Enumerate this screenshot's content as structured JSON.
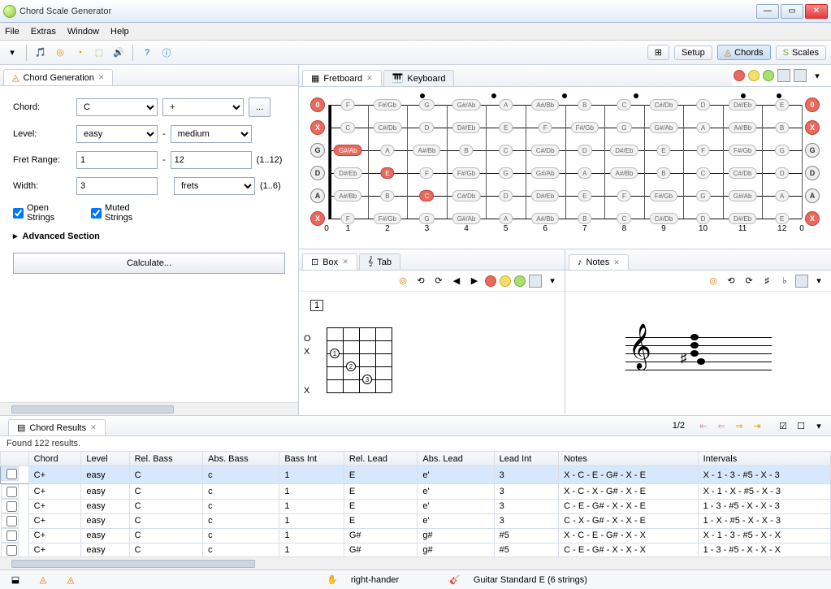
{
  "window": {
    "title": "Chord Scale Generator"
  },
  "menu": [
    "File",
    "Extras",
    "Window",
    "Help"
  ],
  "topmodes": [
    {
      "icon": "layout",
      "label": ""
    },
    {
      "icon": "setup",
      "label": "Setup"
    },
    {
      "icon": "chords",
      "label": "Chords",
      "active": true
    },
    {
      "icon": "scales",
      "label": "Scales"
    }
  ],
  "left": {
    "tab_title": "Chord Generation",
    "labels": {
      "chord": "Chord:",
      "level": "Level:",
      "fretrange": "Fret Range:",
      "width": "Width:"
    },
    "chord_root": "C",
    "chord_qual": "+",
    "dots_btn": "...",
    "level_from": "easy",
    "level_to": "medium",
    "dash": "-",
    "fret_from": "1",
    "fret_to": "12",
    "fret_hint": "(1..12)",
    "width_val": "3",
    "width_unit": "frets",
    "width_hint": "(1..6)",
    "open_strings": "Open Strings",
    "muted_strings": "Muted Strings",
    "advanced": "Advanced Section",
    "calculate": "Calculate..."
  },
  "fretboard": {
    "tabs": [
      "Fretboard",
      "Keyboard"
    ],
    "mark_frets": [
      3,
      5,
      7,
      9,
      12
    ],
    "fret_numbers": [
      0,
      1,
      2,
      3,
      4,
      5,
      6,
      7,
      8,
      9,
      10,
      11,
      12,
      0
    ],
    "nut_left": [
      {
        "txt": "0",
        "cls": "red"
      },
      {
        "txt": "X",
        "cls": "red"
      },
      {
        "txt": "G",
        "cls": "open"
      },
      {
        "txt": "D",
        "cls": "open"
      },
      {
        "txt": "A",
        "cls": "open"
      },
      {
        "txt": "X",
        "cls": "red"
      }
    ],
    "nut_right": [
      {
        "txt": "0",
        "cls": "red"
      },
      {
        "txt": "X",
        "cls": "red"
      },
      {
        "txt": "G",
        "cls": "open"
      },
      {
        "txt": "D",
        "cls": "open"
      },
      {
        "txt": "A",
        "cls": "open"
      },
      {
        "txt": "X",
        "cls": "red"
      }
    ],
    "notes_per_fret": [
      [
        "F",
        "F#/Gb",
        "G",
        "G#/Ab",
        "A",
        "A#/Bb",
        "B",
        "C",
        "C#/Db",
        "D",
        "D#/Eb",
        "E"
      ],
      [
        "C",
        "C#/Db",
        "D",
        "D#/Eb",
        "E",
        "F",
        "F#/Gb",
        "G",
        "G#/Ab",
        "A",
        "A#/Bb",
        "B"
      ],
      [
        "G#/Ab",
        "A",
        "A#/Bb",
        "B",
        "C",
        "C#/Db",
        "D",
        "D#/Eb",
        "E",
        "F",
        "F#/Gb",
        "G"
      ],
      [
        "D#/Eb",
        "E",
        "F",
        "F#/Gb",
        "G",
        "G#/Ab",
        "A",
        "A#/Bb",
        "B",
        "C",
        "C#/Db",
        "D"
      ],
      [
        "A#/Bb",
        "B",
        "C",
        "C#/Db",
        "D",
        "D#/Eb",
        "E",
        "F",
        "F#/Gb",
        "G",
        "G#/Ab",
        "A"
      ],
      [
        "F",
        "F#/Gb",
        "G",
        "G#/Ab",
        "A",
        "A#/Bb",
        "B",
        "C",
        "C#/Db",
        "D",
        "D#/Eb",
        "E"
      ]
    ],
    "hilite": [
      {
        "s": 2,
        "f": 1
      },
      {
        "s": 3,
        "f": 2
      },
      {
        "s": 4,
        "f": 3
      }
    ]
  },
  "box": {
    "tabs": [
      "Box",
      "Tab"
    ],
    "fret_label": "1",
    "left_marks": [
      "",
      "O",
      "X",
      "",
      "",
      "X"
    ]
  },
  "notes_tab": "Notes",
  "results": {
    "tab": "Chord Results",
    "page": "1/2",
    "found": "Found 122 results.",
    "columns": [
      "",
      "Chord",
      "Level",
      "Rel. Bass",
      "Abs. Bass",
      "Bass Int",
      "Rel. Lead",
      "Abs. Lead",
      "Lead Int",
      "Notes",
      "Intervals"
    ],
    "rows": [
      [
        "C+",
        "easy",
        "C",
        "c",
        "1",
        "E",
        "e'",
        "3",
        "X - C - E - G# - X - E",
        "X - 1 - 3 - #5 - X - 3"
      ],
      [
        "C+",
        "easy",
        "C",
        "c",
        "1",
        "E",
        "e'",
        "3",
        "X - C - X - G# - X - E",
        "X - 1 - X - #5 - X - 3"
      ],
      [
        "C+",
        "easy",
        "C",
        "c",
        "1",
        "E",
        "e'",
        "3",
        "C - E - G# - X - X - E",
        "1 - 3 - #5 - X - X - 3"
      ],
      [
        "C+",
        "easy",
        "C",
        "c",
        "1",
        "E",
        "e'",
        "3",
        "C - X - G# - X - X - E",
        "1 - X - #5 - X - X - 3"
      ],
      [
        "C+",
        "easy",
        "C",
        "c",
        "1",
        "G#",
        "g#",
        "#5",
        "X - C - E - G# - X - X",
        "X - 1 - 3 - #5 - X - X"
      ],
      [
        "C+",
        "easy",
        "C",
        "c",
        "1",
        "G#",
        "g#",
        "#5",
        "C - E - G# - X - X - X",
        "1 - 3 - #5 - X - X - X"
      ]
    ]
  },
  "status": {
    "hand": "right-hander",
    "tuning": "Guitar Standard E (6 strings)"
  }
}
